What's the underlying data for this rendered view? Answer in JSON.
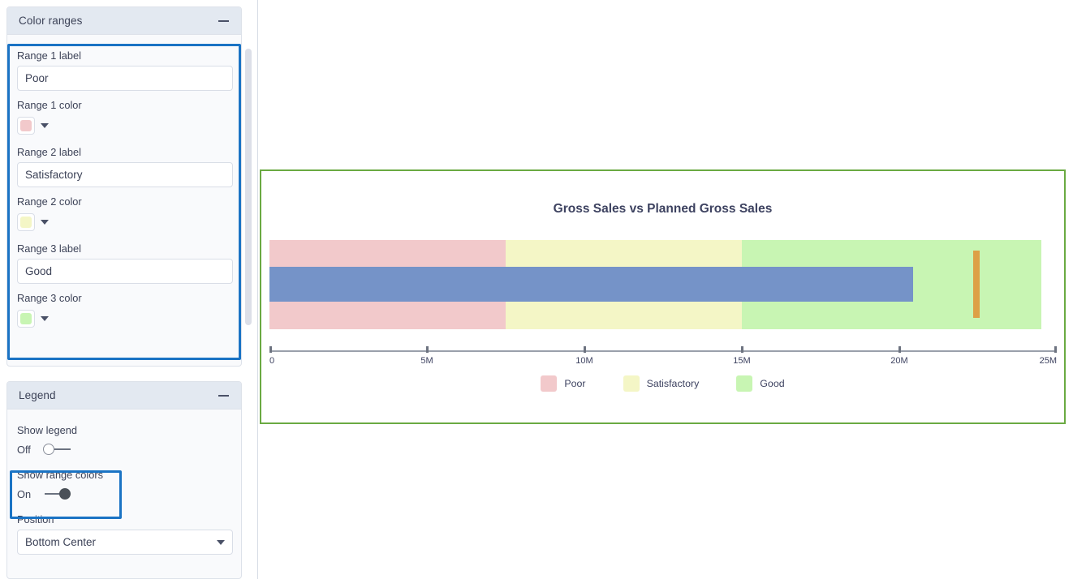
{
  "sidebar": {
    "panels": [
      {
        "title": "Color ranges",
        "collapse_icon": "minus-icon",
        "fields": [
          {
            "label": "Range 1 label",
            "value": "Poor"
          },
          {
            "label": "Range 1 color",
            "color": "#f2c9cb"
          },
          {
            "label": "Range 2 label",
            "value": "Satisfactory"
          },
          {
            "label": "Range 2 color",
            "color": "#f4f6c6"
          },
          {
            "label": "Range 3 label",
            "value": "Good"
          },
          {
            "label": "Range 3 color",
            "color": "#c8f5b3"
          }
        ]
      },
      {
        "title": "Legend",
        "collapse_icon": "minus-icon",
        "show_legend": {
          "label": "Show legend",
          "state": "Off",
          "on": false
        },
        "show_range_colors": {
          "label": "Show range colors",
          "state": "On",
          "on": true
        },
        "position": {
          "label": "Position",
          "value": "Bottom Center",
          "caret": "chevron-down-icon"
        }
      }
    ],
    "scrollbar": {
      "name": "vertical-scrollbar"
    }
  },
  "chart_data": {
    "type": "bar",
    "subtype": "bullet",
    "title": "Gross Sales vs Planned Gross Sales",
    "xlabel": "",
    "ylabel": "",
    "xlim": [
      0,
      25000000
    ],
    "grid": false,
    "axis_ticks": [
      {
        "value": 0,
        "label": "0"
      },
      {
        "value": 5000000,
        "label": "5M"
      },
      {
        "value": 10000000,
        "label": "10M"
      },
      {
        "value": 15000000,
        "label": "15M"
      },
      {
        "value": 20000000,
        "label": "20M"
      },
      {
        "value": 25000000,
        "label": "25M"
      }
    ],
    "ranges": [
      {
        "name": "Poor",
        "from": 0,
        "to": 7500000,
        "color": "#f2c9cb"
      },
      {
        "name": "Satisfactory",
        "from": 7500000,
        "to": 15000000,
        "color": "#f4f6c6"
      },
      {
        "name": "Good",
        "from": 15000000,
        "to": 24500000,
        "color": "#c8f5b3"
      }
    ],
    "measure": {
      "name": "Gross Sales",
      "value": 20450000,
      "color": "#7593c8"
    },
    "target": {
      "name": "Planned Gross Sales",
      "value": 22450000,
      "color": "#dda046"
    },
    "legend": {
      "position": "Bottom Center",
      "entries": [
        {
          "label": "Poor",
          "color": "#f2c9cb"
        },
        {
          "label": "Satisfactory",
          "color": "#f4f6c6"
        },
        {
          "label": "Good",
          "color": "#c8f5b3"
        }
      ]
    },
    "frame_color": "#6aaa42"
  }
}
